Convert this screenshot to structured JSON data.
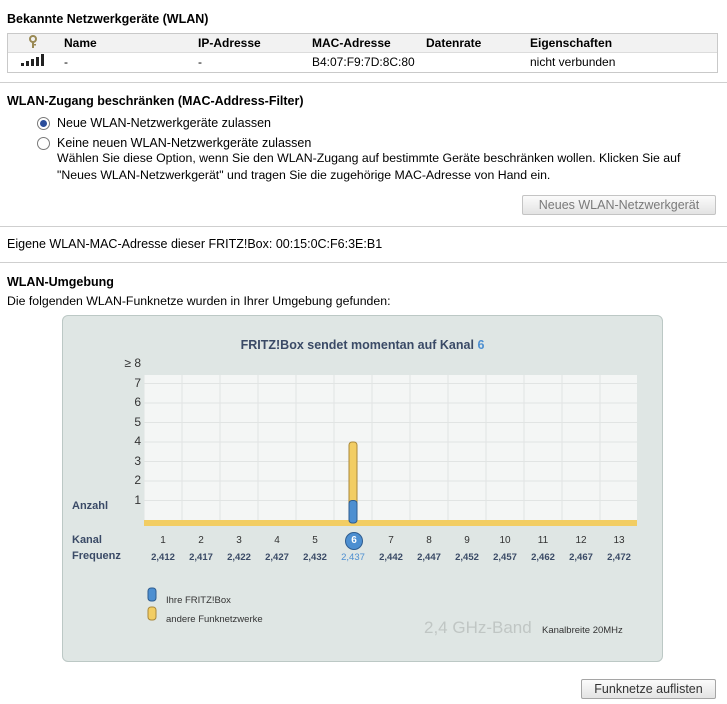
{
  "known_devices": {
    "title": "Bekannte Netzwerkgeräte (WLAN)",
    "columns": [
      "Name",
      "IP-Adresse",
      "MAC-Adresse",
      "Datenrate",
      "Eigenschaften"
    ],
    "rows": [
      {
        "name": "-",
        "ip": "-",
        "mac": "B4:07:F9:7D:8C:80",
        "rate": "",
        "props": "nicht verbunden"
      }
    ]
  },
  "mac_filter": {
    "title": "WLAN-Zugang beschränken (MAC-Address-Filter)",
    "option1": "Neue WLAN-Netzwerkgeräte zulassen",
    "option2": "Keine neuen WLAN-Netzwerkgeräte zulassen",
    "option2_desc": "Wählen Sie diese Option, wenn Sie den WLAN-Zugang auf bestimmte Geräte beschränken wollen. Klicken Sie auf \"Neues WLAN-Netzwerkgerät\" und tragen Sie die zugehörige MAC-Adresse von Hand ein.",
    "selected": 1,
    "new_device_button": "Neues WLAN-Netzwerkgerät"
  },
  "own_mac": "Eigene WLAN-MAC-Adresse dieser FRITZ!Box: 00:15:0C:F6:3E:B1",
  "environment": {
    "title": "WLAN-Umgebung",
    "intro": "Die folgenden WLAN-Funknetze wurden in Ihrer Umgebung gefunden:",
    "list_button": "Funknetze auflisten"
  },
  "chart_data": {
    "type": "bar",
    "title_prefix": "FRITZ!Box sendet momentan auf Kanal",
    "current_channel": "6",
    "ylabel": "Anzahl",
    "yticks": [
      "≥ 8",
      "7",
      "6",
      "5",
      "4",
      "3",
      "2",
      "1"
    ],
    "ylim": [
      0,
      8
    ],
    "row_label_channel": "Kanal",
    "row_label_freq": "Frequenz",
    "categories": [
      "1",
      "2",
      "3",
      "4",
      "5",
      "6",
      "7",
      "8",
      "9",
      "10",
      "11",
      "12",
      "13"
    ],
    "frequencies": [
      "2,412",
      "2,417",
      "2,422",
      "2,427",
      "2,432",
      "2,437",
      "2,442",
      "2,447",
      "2,452",
      "2,457",
      "2,462",
      "2,467",
      "2,472"
    ],
    "series": [
      {
        "name": "Ihre FRITZ!Box",
        "color": "#4d8fd1",
        "values": [
          0,
          0,
          0,
          0,
          0,
          1,
          0,
          0,
          0,
          0,
          0,
          0,
          0
        ]
      },
      {
        "name": "andere Funknetzwerke",
        "color": "#f2cd63",
        "values": [
          0,
          0,
          0,
          0,
          0,
          4,
          0,
          0,
          0,
          0,
          0,
          0,
          0
        ]
      }
    ],
    "band": "2,4 GHz-Band",
    "channel_width": "Kanalbreite 20MHz"
  }
}
